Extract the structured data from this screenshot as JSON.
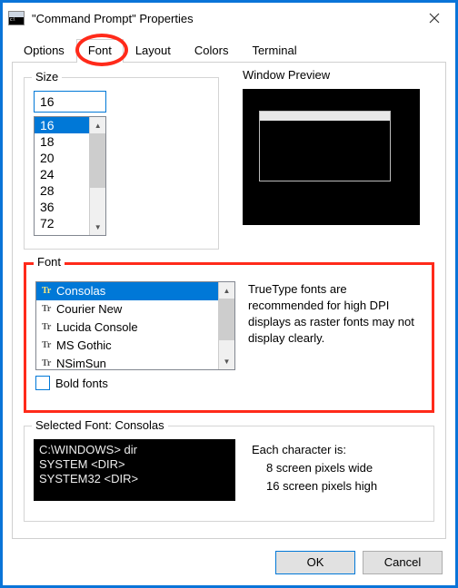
{
  "window": {
    "title": "\"Command Prompt\" Properties"
  },
  "tabs": {
    "items": [
      {
        "label": "Options"
      },
      {
        "label": "Font"
      },
      {
        "label": "Layout"
      },
      {
        "label": "Colors"
      },
      {
        "label": "Terminal"
      }
    ],
    "active_index": 1
  },
  "size_group": {
    "label": "Size",
    "edit_value": "16",
    "items": [
      "16",
      "18",
      "20",
      "24",
      "28",
      "36",
      "72"
    ],
    "selected_index": 0
  },
  "preview": {
    "label": "Window Preview"
  },
  "font_group": {
    "label": "Font",
    "items": [
      {
        "name": "Consolas"
      },
      {
        "name": "Courier New"
      },
      {
        "name": "Lucida Console"
      },
      {
        "name": "MS Gothic"
      },
      {
        "name": "NSimSun"
      }
    ],
    "selected_index": 0,
    "bold_label": "Bold fonts",
    "bold_checked": false,
    "description": "TrueType fonts are recommended for high DPI displays as raster fonts may not display clearly."
  },
  "selected_font_group": {
    "label": "Selected Font: Consolas",
    "sample_lines": [
      "C:\\WINDOWS> dir",
      "SYSTEM       <DIR>",
      "SYSTEM32     <DIR>"
    ],
    "char_desc_heading": "Each character is:",
    "char_width": "8 screen pixels wide",
    "char_height": "16 screen pixels high"
  },
  "buttons": {
    "ok": "OK",
    "cancel": "Cancel"
  }
}
